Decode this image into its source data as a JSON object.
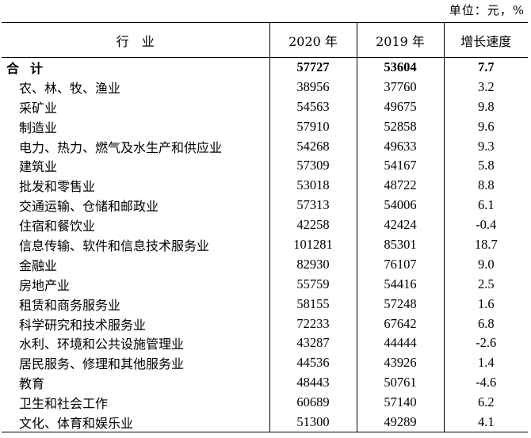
{
  "unit": "单位：元，%",
  "header": {
    "industry": "行　业",
    "y2020": "2020 年",
    "y2019": "2019 年",
    "growth": "增长速度"
  },
  "rows": [
    {
      "name": "合计",
      "v2020": "57727",
      "v2019": "53604",
      "growth": "7.7"
    },
    {
      "name": "农、林、牧、渔业",
      "v2020": "38956",
      "v2019": "37760",
      "growth": "3.2"
    },
    {
      "name": "采矿业",
      "v2020": "54563",
      "v2019": "49675",
      "growth": "9.8"
    },
    {
      "name": "制造业",
      "v2020": "57910",
      "v2019": "52858",
      "growth": "9.6"
    },
    {
      "name": "电力、热力、燃气及水生产和供应业",
      "v2020": "54268",
      "v2019": "49633",
      "growth": "9.3"
    },
    {
      "name": "建筑业",
      "v2020": "57309",
      "v2019": "54167",
      "growth": "5.8"
    },
    {
      "name": "批发和零售业",
      "v2020": "53018",
      "v2019": "48722",
      "growth": "8.8"
    },
    {
      "name": "交通运输、仓储和邮政业",
      "v2020": "57313",
      "v2019": "54006",
      "growth": "6.1"
    },
    {
      "name": "住宿和餐饮业",
      "v2020": "42258",
      "v2019": "42424",
      "growth": "-0.4"
    },
    {
      "name": "信息传输、软件和信息技术服务业",
      "v2020": "101281",
      "v2019": "85301",
      "growth": "18.7"
    },
    {
      "name": "金融业",
      "v2020": "82930",
      "v2019": "76107",
      "growth": "9.0"
    },
    {
      "name": "房地产业",
      "v2020": "55759",
      "v2019": "54416",
      "growth": "2.5"
    },
    {
      "name": "租赁和商务服务业",
      "v2020": "58155",
      "v2019": "57248",
      "growth": "1.6"
    },
    {
      "name": "科学研究和技术服务业",
      "v2020": "72233",
      "v2019": "67642",
      "growth": "6.8"
    },
    {
      "name": "水利、环境和公共设施管理业",
      "v2020": "43287",
      "v2019": "44444",
      "growth": "-2.6"
    },
    {
      "name": "居民服务、修理和其他服务业",
      "v2020": "44536",
      "v2019": "43926",
      "growth": "1.4"
    },
    {
      "name": "教育",
      "v2020": "48443",
      "v2019": "50761",
      "growth": "-4.6"
    },
    {
      "name": "卫生和社会工作",
      "v2020": "60689",
      "v2019": "57140",
      "growth": "6.2"
    },
    {
      "name": "文化、体育和娱乐业",
      "v2020": "51300",
      "v2019": "49289",
      "growth": "4.1"
    }
  ]
}
